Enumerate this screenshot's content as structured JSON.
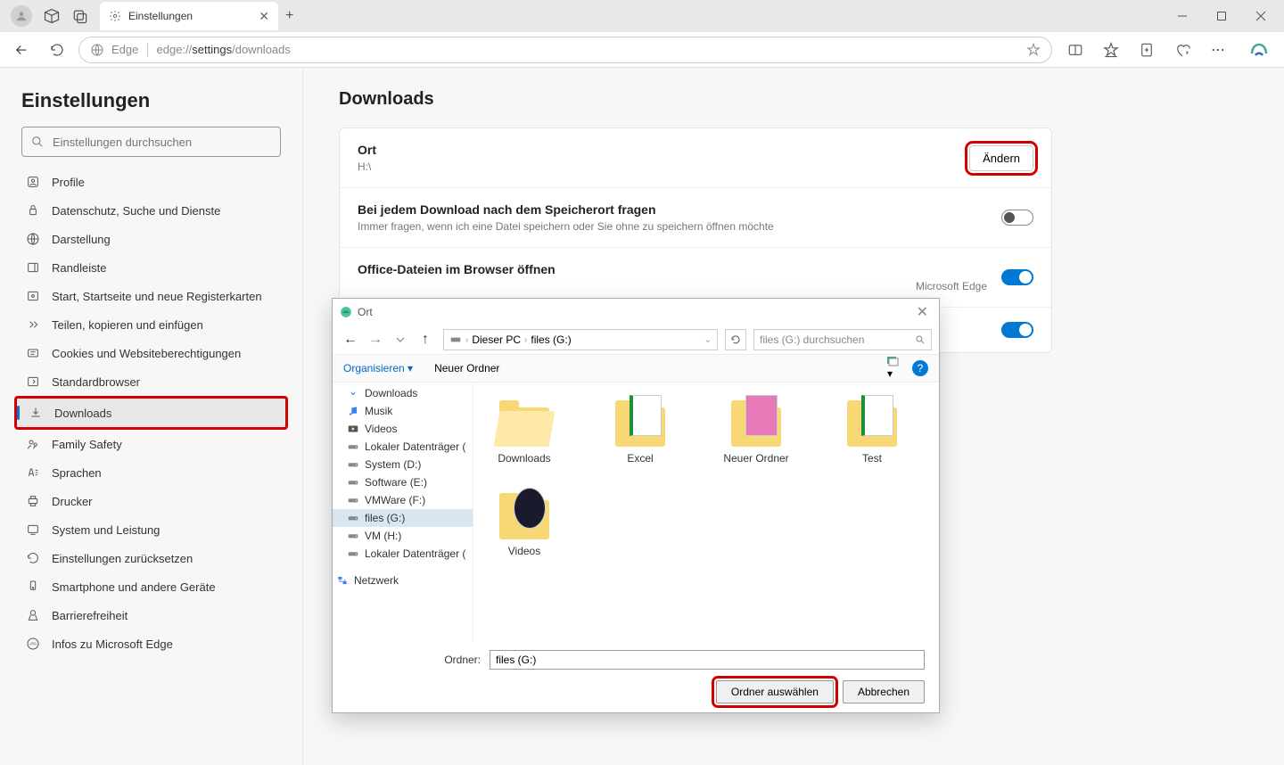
{
  "titlebar": {
    "tab_title": "Einstellungen"
  },
  "toolbar": {
    "addr_prefix": "Edge",
    "addr_protocol": "edge://",
    "addr_path1": "settings",
    "addr_path2": "/downloads"
  },
  "sidebar": {
    "heading": "Einstellungen",
    "search_placeholder": "Einstellungen durchsuchen",
    "items": [
      {
        "label": "Profile"
      },
      {
        "label": "Datenschutz, Suche und Dienste"
      },
      {
        "label": "Darstellung"
      },
      {
        "label": "Randleiste"
      },
      {
        "label": "Start, Startseite und neue Registerkarten"
      },
      {
        "label": "Teilen, kopieren und einfügen"
      },
      {
        "label": "Cookies und Websiteberechtigungen"
      },
      {
        "label": "Standardbrowser"
      },
      {
        "label": "Downloads"
      },
      {
        "label": "Family Safety"
      },
      {
        "label": "Sprachen"
      },
      {
        "label": "Drucker"
      },
      {
        "label": "System und Leistung"
      },
      {
        "label": "Einstellungen zurücksetzen"
      },
      {
        "label": "Smartphone und andere Geräte"
      },
      {
        "label": "Barrierefreiheit"
      },
      {
        "label": "Infos zu Microsoft Edge"
      }
    ]
  },
  "content": {
    "heading": "Downloads",
    "rows": {
      "location": {
        "title": "Ort",
        "sub": "H:\\",
        "button": "Ändern"
      },
      "ask": {
        "title": "Bei jedem Download nach dem Speicherort fragen",
        "sub": "Immer fragen, wenn ich eine Datei speichern oder Sie ohne zu speichern öffnen möchte"
      },
      "office": {
        "title": "Office-Dateien im Browser öffnen",
        "sub_tail": "Microsoft Edge"
      },
      "row4": {
        "title": ""
      }
    }
  },
  "dialog": {
    "title": "Ort",
    "breadcrumb": {
      "pc": "Dieser PC",
      "drive": "files (G:)"
    },
    "search_placeholder": "files (G:) durchsuchen",
    "toolbar": {
      "organize": "Organisieren",
      "new_folder": "Neuer Ordner"
    },
    "tree": [
      {
        "label": "Downloads",
        "icon": "download"
      },
      {
        "label": "Musik",
        "icon": "music"
      },
      {
        "label": "Videos",
        "icon": "video"
      },
      {
        "label": "Lokaler Datenträger (",
        "icon": "drive"
      },
      {
        "label": "System (D:)",
        "icon": "drive"
      },
      {
        "label": "Software (E:)",
        "icon": "drive"
      },
      {
        "label": "VMWare (F:)",
        "icon": "drive"
      },
      {
        "label": "files (G:)",
        "icon": "drive",
        "selected": true
      },
      {
        "label": "VM (H:)",
        "icon": "drive"
      },
      {
        "label": "Lokaler Datenträger (",
        "icon": "drive"
      },
      {
        "label": "Netzwerk",
        "icon": "network"
      }
    ],
    "files": [
      {
        "label": "Downloads",
        "type": "folder"
      },
      {
        "label": "Excel",
        "type": "folder-doc"
      },
      {
        "label": "Neuer Ordner",
        "type": "folder-img"
      },
      {
        "label": "Test",
        "type": "folder-doc"
      },
      {
        "label": "Videos",
        "type": "folder-vid"
      }
    ],
    "field_label": "Ordner:",
    "field_value": "files (G:)",
    "btn_select": "Ordner auswählen",
    "btn_cancel": "Abbrechen"
  }
}
